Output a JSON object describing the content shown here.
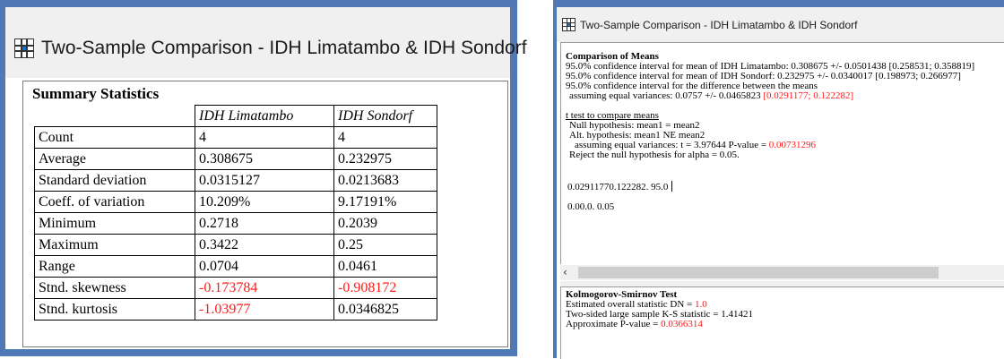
{
  "left": {
    "window_title": "Two-Sample Comparison - IDH Limatambo & IDH Sondorf",
    "summary_heading": "Summary Statistics",
    "columns": [
      "IDH Limatambo",
      "IDH Sondorf"
    ],
    "rows": [
      {
        "label": "Count",
        "v1": "4",
        "v2": "4"
      },
      {
        "label": "Average",
        "v1": "0.308675",
        "v2": "0.232975"
      },
      {
        "label": "Standard deviation",
        "v1": "0.0315127",
        "v2": "0.0213683"
      },
      {
        "label": "Coeff. of variation",
        "v1": "10.209%",
        "v2": "9.17191%"
      },
      {
        "label": "Minimum",
        "v1": "0.2718",
        "v2": "0.2039"
      },
      {
        "label": "Maximum",
        "v1": "0.3422",
        "v2": "0.25"
      },
      {
        "label": "Range",
        "v1": "0.0704",
        "v2": "0.0461"
      },
      {
        "label": "Stnd. skewness",
        "v1": "-0.173784",
        "v2": "-0.908172"
      },
      {
        "label": "Stnd. kurtosis",
        "v1": "-1.03977",
        "v2": "0.0346825"
      }
    ],
    "highlight_color": "#ff1a1a"
  },
  "right": {
    "window_title": "Two-Sample Comparison - IDH Limatambo & IDH Sondorf",
    "comparison_heading": "Comparison of Means",
    "ci_mean1": {
      "text": "95.0% confidence interval for mean of IDH Limatambo: 0.308675 +/- 0.0501438   [0.258531; 0.358819]"
    },
    "ci_mean2": {
      "text": "95.0% confidence interval for mean of IDH Sondorf: 0.232975 +/- 0.0340017   [0.198973; 0.266977]"
    },
    "ci_diff": {
      "text": "95.0% confidence interval for the difference between the means"
    },
    "ci_diff_eq": {
      "prefix": "assuming equal variances: 0.0757 +/- 0.0465823   ",
      "red": "[0.0291177; 0.122282]"
    },
    "ttest_heading": "t test to compare means",
    "null_hyp": "Null hypothesis: mean1 = mean2",
    "alt_hyp": "Alt. hypothesis: mean1 NE mean2",
    "ttest_eq": {
      "prefix": "assuming equal variances: t = 3.97644   P-value = ",
      "red": "0.00731296"
    },
    "reject": "Reject the null hypothesis for alpha = 0.05.",
    "input_line": "0.02911770.122282.  95.0",
    "input_line2": "0.00.0.  0.05",
    "ks": {
      "heading": "Kolmogorov-Smirnov Test",
      "dn_prefix": "Estimated overall statistic DN = ",
      "dn_red": "1.0",
      "two_sided": "Two-sided large sample K-S statistic = 1.41421",
      "pval_prefix": "Approximate P-value = ",
      "pval_red": "0.0366314"
    },
    "scroll_left_arrow": "‹",
    "highlight_color": "#ff1a1a"
  }
}
